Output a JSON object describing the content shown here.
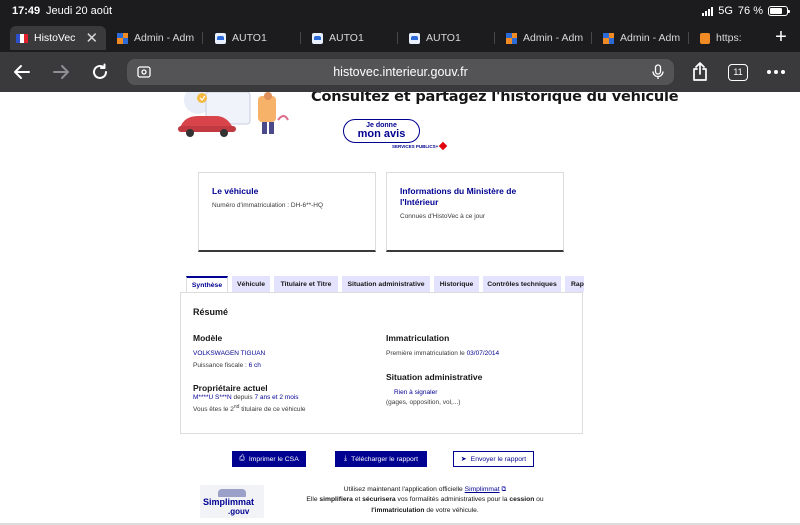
{
  "status_bar": {
    "time": "17:49",
    "date": "Jeudi 20 août",
    "network": "5G",
    "battery": "76 %",
    "battery_level": 0.76
  },
  "browser_tabs": [
    {
      "label": "HistoVec",
      "favicon": "french-flag-icon",
      "active": true
    },
    {
      "label": "Admin - Adm",
      "favicon": "admin-grid-icon",
      "active": false
    },
    {
      "label": "AUTO1",
      "favicon": "auto1-icon",
      "active": false
    },
    {
      "label": "AUTO1",
      "favicon": "auto1-icon",
      "active": false
    },
    {
      "label": "AUTO1",
      "favicon": "auto1-icon",
      "active": false
    },
    {
      "label": "Admin - Adm",
      "favicon": "admin-grid-icon",
      "active": false
    },
    {
      "label": "Admin - Adm",
      "favicon": "admin-grid-icon",
      "active": false
    },
    {
      "label": "https:",
      "favicon": "https-icon",
      "active": false
    }
  ],
  "toolbar": {
    "url": "histovec.interieur.gouv.fr",
    "tab_count": "11"
  },
  "hero": {
    "headline": "Consultez et partagez l'historique du véhicule",
    "feedback_line1": "Je donne",
    "feedback_line2": "mon avis",
    "services_publics": "SERVICES PUBLICS+"
  },
  "cards": [
    {
      "title": "Le véhicule",
      "subtitle": "Numéro d'immatriculation : DH-6**-HQ"
    },
    {
      "title": "Informations du Ministère de l'Intérieur",
      "subtitle": "Connues d'HistoVec à ce jour"
    }
  ],
  "page_tabs": [
    "Synthèse",
    "Véhicule",
    "Titulaire et Titre",
    "Situation administrative",
    "Historique",
    "Contrôles techniques",
    "Rap"
  ],
  "active_tab": "Synthèse",
  "summary": {
    "title": "Résumé",
    "model_heading": "Modèle",
    "model_value": "VOLKSWAGEN TIGUAN",
    "power_label": "Puissance fiscale : ",
    "power_value": "6 ch",
    "owner_heading": "Propriétaire actuel",
    "owner_name": "M****U S***N",
    "owner_since_label": " depuis ",
    "owner_since_value": "7 ans et 2 mois",
    "holder_prefix": "Vous êtes le 2",
    "holder_sup": "nd",
    "holder_suffix": " titulaire de ce véhicule",
    "registration_heading": "Immatriculation",
    "registration_label": "Première immatriculation le ",
    "registration_date": "03/07/2014",
    "admin_heading": "Situation administrative",
    "admin_value": "Rien à signaler",
    "admin_note": "(gages, opposition, vol,...)"
  },
  "actions": {
    "print": "Imprimer le CSA",
    "download": "Télécharger le rapport",
    "send": "Envoyer le rapport"
  },
  "promo": {
    "logo_line1": "Simplimmat",
    "logo_line2": ".gouv",
    "text1": "Utilisez maintenant l'application officielle ",
    "link": "Simplimmat",
    "text2a": "Elle ",
    "bold1": "simplifiera",
    "text2b": " et ",
    "bold2": "sécurisera",
    "text2c": " vos formalités administratives pour la ",
    "bold3": "cession",
    "text2d": " ou",
    "bold4": "l'immatriculation",
    "text3": " de votre véhicule."
  },
  "colors": {
    "brand": "#000091",
    "tab_inactive_bg": "#e3e3fd",
    "browser_chrome": "#1c1c1e",
    "toolbar": "#3a3a3c"
  }
}
